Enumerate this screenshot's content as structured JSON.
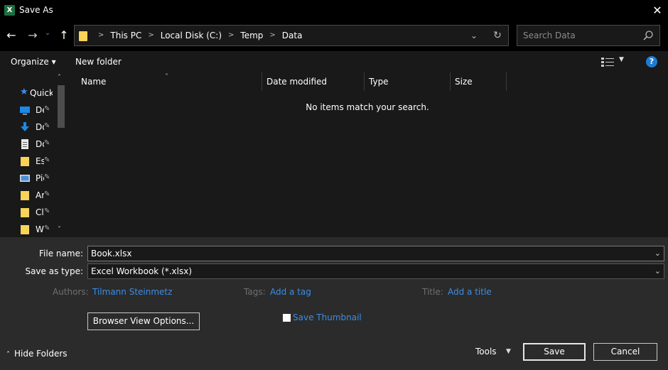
{
  "window": {
    "title": "Save As",
    "app_icon": "excel-icon",
    "close_glyph": "✕"
  },
  "nav": {
    "back_glyph": "←",
    "forward_glyph": "→",
    "recent_glyph": "⌄",
    "up_glyph": "↑",
    "breadcrumbs": [
      "This PC",
      "Local Disk (C:)",
      "Temp",
      "Data"
    ],
    "breadcrumb_sep": ">",
    "search_placeholder": "Search Data"
  },
  "toolbar": {
    "organize": "Organize ▾",
    "new_folder": "New folder",
    "help": "?"
  },
  "sidebar": {
    "items": [
      {
        "label": "Quick access",
        "icon": "star-icon"
      },
      {
        "label": "Desktop",
        "icon": "desktop-icon"
      },
      {
        "label": "Downloads",
        "icon": "download-icon"
      },
      {
        "label": "Documents",
        "icon": "document-icon"
      },
      {
        "label": "Es",
        "icon": "folder-icon"
      },
      {
        "label": "Pictures",
        "icon": "pictures-icon"
      },
      {
        "label": "Ar",
        "icon": "folder-icon"
      },
      {
        "label": "Cl",
        "icon": "folder-icon"
      },
      {
        "label": "W",
        "icon": "folder-icon"
      }
    ]
  },
  "file_list": {
    "columns": [
      "Name",
      "Date modified",
      "Type",
      "Size"
    ],
    "empty_message": "No items match your search."
  },
  "form": {
    "file_name_label": "File name:",
    "file_name_value": "Book.xlsx",
    "save_type_label": "Save as type:",
    "save_type_value": "Excel Workbook (*.xlsx)",
    "authors_label": "Authors:",
    "authors_value": "Tilmann Steinmetz",
    "tags_label": "Tags:",
    "tags_value": "Add a tag",
    "title_label": "Title:",
    "title_value": "Add a title",
    "browser_view_button": "Browser View Options...",
    "save_thumbnail_label": "Save Thumbnail",
    "save_thumbnail_checked": false
  },
  "footer": {
    "hide_folders": "Hide Folders",
    "tools": "Tools",
    "save": "Save",
    "cancel": "Cancel"
  },
  "colors": {
    "accent": "#3a8ee6",
    "help": "#1e7bd6",
    "folder": "#f7d358",
    "excel": "#1d6f42"
  }
}
